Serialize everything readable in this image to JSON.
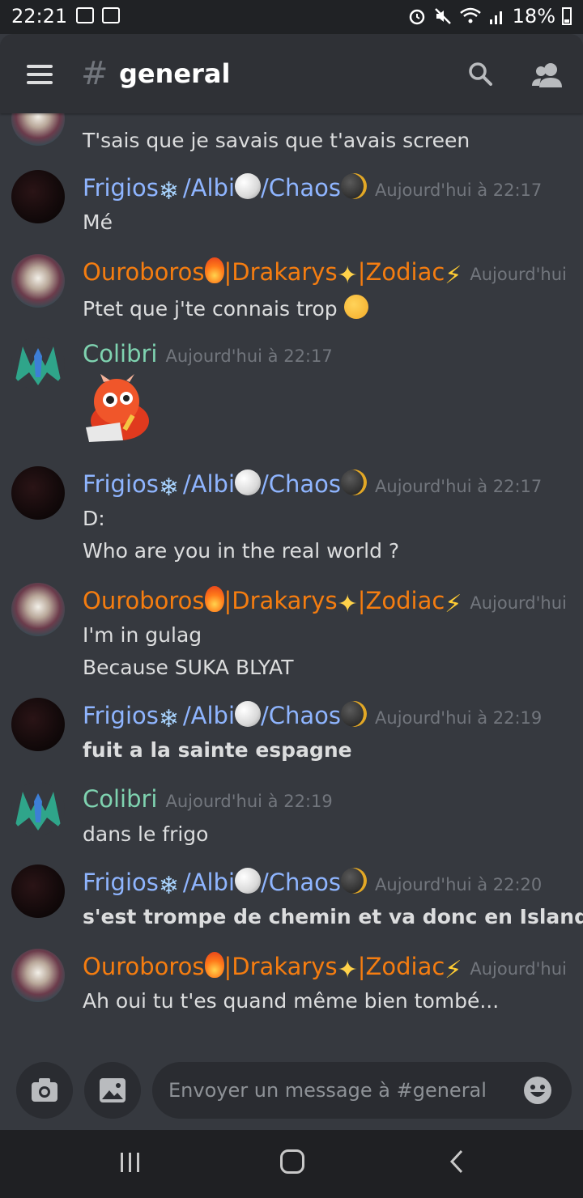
{
  "status_bar": {
    "time": "22:21",
    "battery": "18%"
  },
  "header": {
    "channel_name": "general"
  },
  "messages": [
    {
      "id": "m0",
      "lines": [
        "T'sais que je savais que t'avais screen"
      ]
    },
    {
      "id": "m1",
      "user": "Frigios",
      "time": "Aujourd'hui à 22:17",
      "lines": [
        "Mé"
      ]
    },
    {
      "id": "m2",
      "user": "Ouroboros",
      "time": "Aujourd'hui",
      "lines": [
        "Ptet que j'te connais trop"
      ]
    },
    {
      "id": "m3",
      "user": "Colibri",
      "time": "Aujourd'hui à 22:17",
      "lines": []
    },
    {
      "id": "m4",
      "user": "Frigios",
      "time": "Aujourd'hui à 22:17",
      "lines": [
        "D:",
        "Who are you in the real world ?"
      ]
    },
    {
      "id": "m5",
      "user": "Ouroboros",
      "time": "Aujourd'hui",
      "lines": [
        "I'm in gulag",
        "Because SUKA BLYAT"
      ]
    },
    {
      "id": "m6",
      "user": "Frigios",
      "time": "Aujourd'hui à 22:19",
      "lines": [
        "fuit a la sainte espagne"
      ]
    },
    {
      "id": "m7",
      "user": "Colibri",
      "time": "Aujourd'hui à 22:19",
      "lines": [
        "dans le frigo"
      ]
    },
    {
      "id": "m8",
      "user": "Frigios",
      "time": "Aujourd'hui à 22:20",
      "lines": [
        "s'est trompe de chemin et va donc en Islande"
      ]
    },
    {
      "id": "m9",
      "user": "Ouroboros",
      "time": "Aujourd'hui",
      "lines": [
        "Ah oui tu t'es quand même bien tombé..."
      ]
    }
  ],
  "names": {
    "frigios": [
      "Frigios",
      "/Albi",
      "/Chaos"
    ],
    "ouroboros": [
      "Ouroboros",
      "|Drakarys",
      "|Zodiac"
    ],
    "colibri": "Colibri"
  },
  "composer": {
    "placeholder": "Envoyer un message à #general"
  },
  "icons": {
    "hash": "#",
    "snowflake": "❄",
    "star": "✦",
    "bolt": "⚡"
  },
  "colors": {
    "frigios": "#8fb5ff",
    "ouroboros": "#f57d10",
    "colibri": "#7fd3b0",
    "background": "#36393f",
    "header": "#2f3136"
  }
}
